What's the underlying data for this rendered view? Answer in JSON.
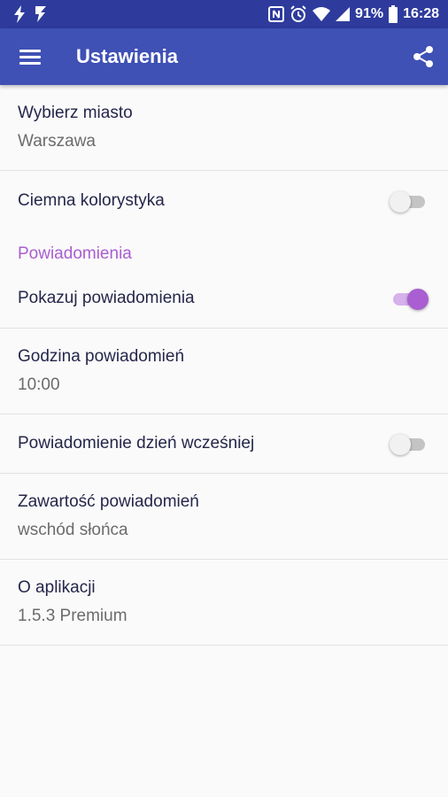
{
  "statusbar": {
    "left_icons": [
      "flash-icon",
      "flash-auto-icon"
    ],
    "right_icons": [
      "nfc-icon",
      "alarm-icon",
      "wifi-icon",
      "signal-icon"
    ],
    "battery": "91%",
    "time": "16:28"
  },
  "appbar": {
    "title": "Ustawienia",
    "color": "#3f51b5",
    "status_color": "#2e3b9c"
  },
  "settings": {
    "city": {
      "title": "Wybierz miasto",
      "summary": "Warszawa"
    },
    "dark_theme": {
      "title": "Ciemna kolorystyka",
      "enabled": false
    },
    "notifications_category": "Powiadomienia",
    "show_notifications": {
      "title": "Pokazuj powiadomienia",
      "enabled": true
    },
    "notification_time": {
      "title": "Godzina powiadomień",
      "summary": "10:00"
    },
    "day_before": {
      "title": "Powiadomienie dzień wcześniej",
      "enabled": false
    },
    "notification_content": {
      "title": "Zawartość powiadomień",
      "summary": "wschód słońca"
    },
    "about": {
      "title": "O aplikacji",
      "summary": "1.5.3 Premium"
    },
    "accent_color": "#a95ed1"
  }
}
